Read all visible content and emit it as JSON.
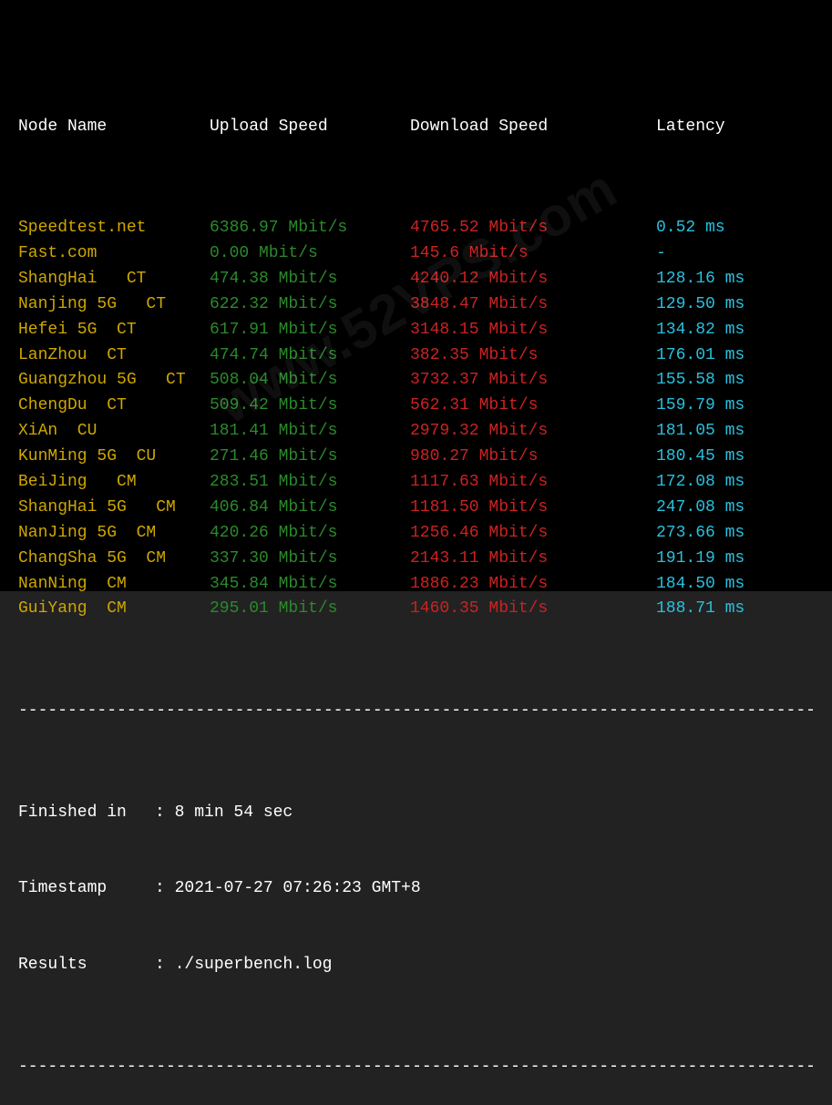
{
  "headers": {
    "node": "Node Name",
    "upload": "Upload Speed",
    "download": "Download Speed",
    "latency": "Latency"
  },
  "rows": [
    {
      "node": "Speedtest.net",
      "upload": "6386.97 Mbit/s",
      "download": "4765.52 Mbit/s",
      "latency": "0.52 ms"
    },
    {
      "node": "Fast.com",
      "upload": "0.00 Mbit/s",
      "download": "145.6 Mbit/s",
      "latency": "-"
    },
    {
      "node": "ShangHai   CT",
      "upload": "474.38 Mbit/s",
      "download": "4240.12 Mbit/s",
      "latency": "128.16 ms"
    },
    {
      "node": "Nanjing 5G   CT",
      "upload": "622.32 Mbit/s",
      "download": "3848.47 Mbit/s",
      "latency": "129.50 ms"
    },
    {
      "node": "Hefei 5G  CT",
      "upload": "617.91 Mbit/s",
      "download": "3148.15 Mbit/s",
      "latency": "134.82 ms"
    },
    {
      "node": "LanZhou  CT",
      "upload": "474.74 Mbit/s",
      "download": "382.35 Mbit/s",
      "latency": "176.01 ms"
    },
    {
      "node": "Guangzhou 5G   CT",
      "upload": "508.04 Mbit/s",
      "download": "3732.37 Mbit/s",
      "latency": "155.58 ms"
    },
    {
      "node": "ChengDu  CT",
      "upload": "509.42 Mbit/s",
      "download": "562.31 Mbit/s",
      "latency": "159.79 ms"
    },
    {
      "node": "XiAn  CU",
      "upload": "181.41 Mbit/s",
      "download": "2979.32 Mbit/s",
      "latency": "181.05 ms"
    },
    {
      "node": "KunMing 5G  CU",
      "upload": "271.46 Mbit/s",
      "download": "980.27 Mbit/s",
      "latency": "180.45 ms"
    },
    {
      "node": "BeiJing   CM",
      "upload": "283.51 Mbit/s",
      "download": "1117.63 Mbit/s",
      "latency": "172.08 ms"
    },
    {
      "node": "ShangHai 5G   CM",
      "upload": "406.84 Mbit/s",
      "download": "1181.50 Mbit/s",
      "latency": "247.08 ms"
    },
    {
      "node": "NanJing 5G  CM",
      "upload": "420.26 Mbit/s",
      "download": "1256.46 Mbit/s",
      "latency": "273.66 ms"
    },
    {
      "node": "ChangSha 5G  CM",
      "upload": "337.30 Mbit/s",
      "download": "2143.11 Mbit/s",
      "latency": "191.19 ms"
    },
    {
      "node": "NanNing  CM",
      "upload": "345.84 Mbit/s",
      "download": "1886.23 Mbit/s",
      "latency": "184.50 ms"
    },
    {
      "node": "GuiYang  CM",
      "upload": "295.01 Mbit/s",
      "download": "1460.35 Mbit/s",
      "latency": "188.71 ms"
    }
  ],
  "divider": "----------------------------------------------------------------------------------",
  "footer": {
    "finished_label": "Finished in",
    "finished_value": "8 min 54 sec",
    "timestamp_label": "Timestamp",
    "timestamp_value": "2021-07-27 07:26:23 GMT+8",
    "results_label": "Results",
    "results_value": "./superbench.log"
  },
  "watermark": "www.52VPS.com",
  "chart_data": {
    "type": "table",
    "title": "Speedtest / Superbench Results",
    "columns": [
      "Node Name",
      "Upload Speed (Mbit/s)",
      "Download Speed (Mbit/s)",
      "Latency (ms)"
    ],
    "data": [
      [
        "Speedtest.net",
        6386.97,
        4765.52,
        0.52
      ],
      [
        "Fast.com",
        0.0,
        145.6,
        null
      ],
      [
        "ShangHai CT",
        474.38,
        4240.12,
        128.16
      ],
      [
        "Nanjing 5G CT",
        622.32,
        3848.47,
        129.5
      ],
      [
        "Hefei 5G CT",
        617.91,
        3148.15,
        134.82
      ],
      [
        "LanZhou CT",
        474.74,
        382.35,
        176.01
      ],
      [
        "Guangzhou 5G CT",
        508.04,
        3732.37,
        155.58
      ],
      [
        "ChengDu CT",
        509.42,
        562.31,
        159.79
      ],
      [
        "XiAn CU",
        181.41,
        2979.32,
        181.05
      ],
      [
        "KunMing 5G CU",
        271.46,
        980.27,
        180.45
      ],
      [
        "BeiJing CM",
        283.51,
        1117.63,
        172.08
      ],
      [
        "ShangHai 5G CM",
        406.84,
        1181.5,
        247.08
      ],
      [
        "NanJing 5G CM",
        420.26,
        1256.46,
        273.66
      ],
      [
        "ChangSha 5G CM",
        337.3,
        2143.11,
        191.19
      ],
      [
        "NanNing CM",
        345.84,
        1886.23,
        184.5
      ],
      [
        "GuiYang CM",
        295.01,
        1460.35,
        188.71
      ]
    ]
  }
}
